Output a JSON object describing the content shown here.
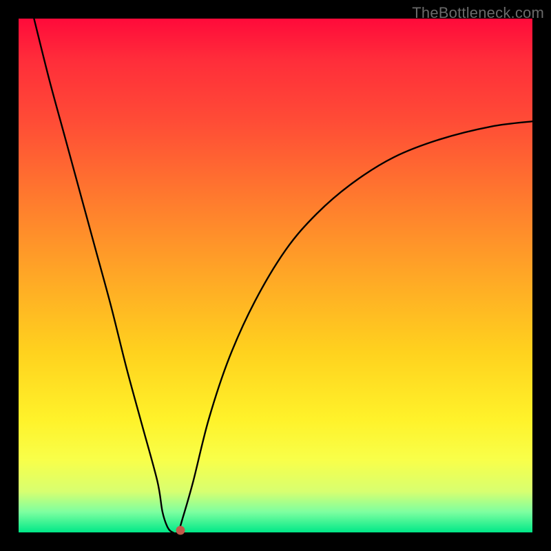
{
  "watermark": "TheBottleneck.com",
  "chart_data": {
    "type": "line",
    "title": "",
    "xlabel": "",
    "ylabel": "",
    "xlim": [
      0,
      100
    ],
    "ylim": [
      0,
      100
    ],
    "grid": false,
    "legend": false,
    "series": [
      {
        "name": "bottleneck-curve",
        "x": [
          3,
          6,
          9,
          12,
          15,
          18,
          21,
          24,
          27,
          28,
          29,
          30,
          31,
          32,
          34,
          37,
          41,
          46,
          52,
          58,
          65,
          73,
          82,
          92,
          100
        ],
        "values": [
          100,
          88,
          77,
          66,
          55,
          44,
          32,
          21,
          10,
          4,
          1,
          0,
          0,
          3,
          10,
          22,
          34,
          45,
          55,
          62,
          68,
          73,
          76.5,
          79,
          80
        ]
      }
    ],
    "marker": {
      "x": 31.5,
      "value": 0.4,
      "color": "#c05a4a"
    },
    "background_gradient": {
      "stops": [
        {
          "pos": 0,
          "color": "#ff0a3a"
        },
        {
          "pos": 8,
          "color": "#ff2d3a"
        },
        {
          "pos": 20,
          "color": "#ff4c36"
        },
        {
          "pos": 35,
          "color": "#ff7a2e"
        },
        {
          "pos": 50,
          "color": "#ffa726"
        },
        {
          "pos": 65,
          "color": "#ffd21e"
        },
        {
          "pos": 78,
          "color": "#fff22a"
        },
        {
          "pos": 86,
          "color": "#f8ff4a"
        },
        {
          "pos": 92,
          "color": "#d8ff70"
        },
        {
          "pos": 96,
          "color": "#7effa0"
        },
        {
          "pos": 100,
          "color": "#00e888"
        }
      ]
    }
  }
}
